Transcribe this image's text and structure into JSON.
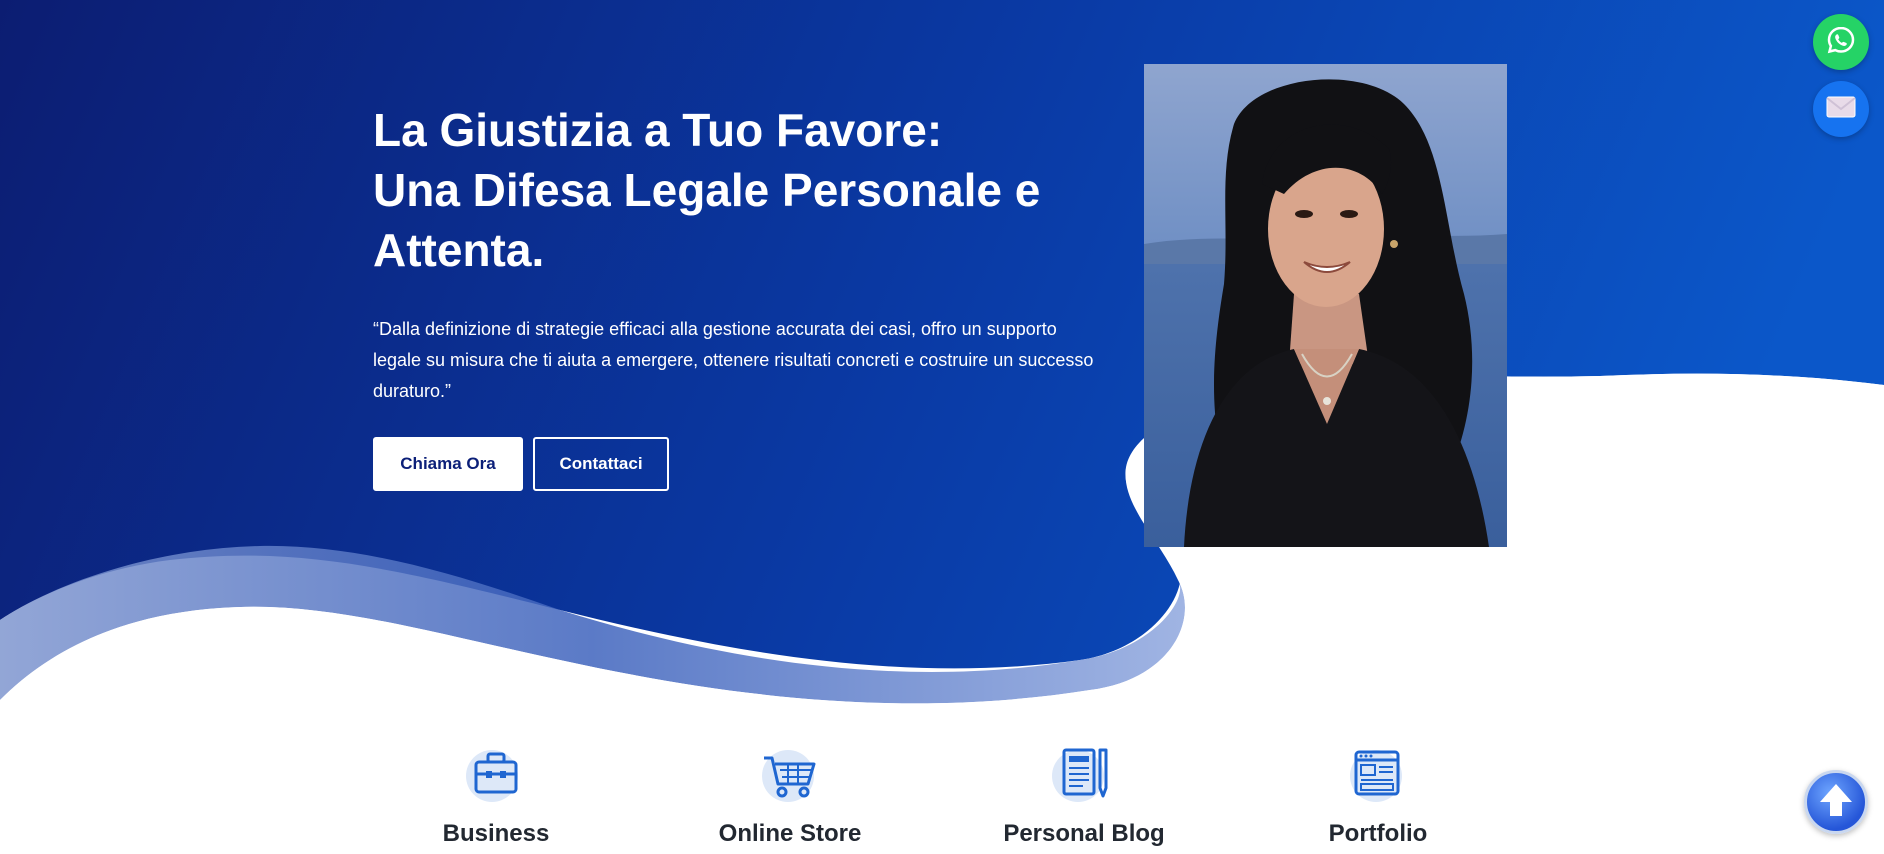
{
  "hero": {
    "title_line1": "La Giustizia a Tuo Favore:",
    "title_line2": "Una Difesa Legale Personale e",
    "title_line3": "Attenta.",
    "description": "“Dalla definizione di strategie efficaci alla gestione accurata dei casi, offro un supporto legale su misura che ti aiuta a emergere, ottenere risultati concreti e costruire un successo duraturo.”",
    "primary_button": "Chiama Ora",
    "secondary_button": "Contattaci"
  },
  "features": [
    {
      "label": "Business",
      "icon": "briefcase-icon"
    },
    {
      "label": "Online Store",
      "icon": "cart-icon"
    },
    {
      "label": "Personal Blog",
      "icon": "document-pen-icon"
    },
    {
      "label": "Portfolio",
      "icon": "web-page-icon"
    }
  ],
  "floating": {
    "whatsapp_icon": "whatsapp-icon",
    "mail_icon": "envelope-icon",
    "scroll_top_icon": "arrow-up-icon"
  },
  "colors": {
    "hero_dark": "#0b1a72",
    "hero_mid": "#0a3aa8",
    "hero_light": "#0b57c9",
    "icon_blue": "#1f66d1",
    "whatsapp_green": "#25d366",
    "mail_blue": "#1673f0"
  }
}
